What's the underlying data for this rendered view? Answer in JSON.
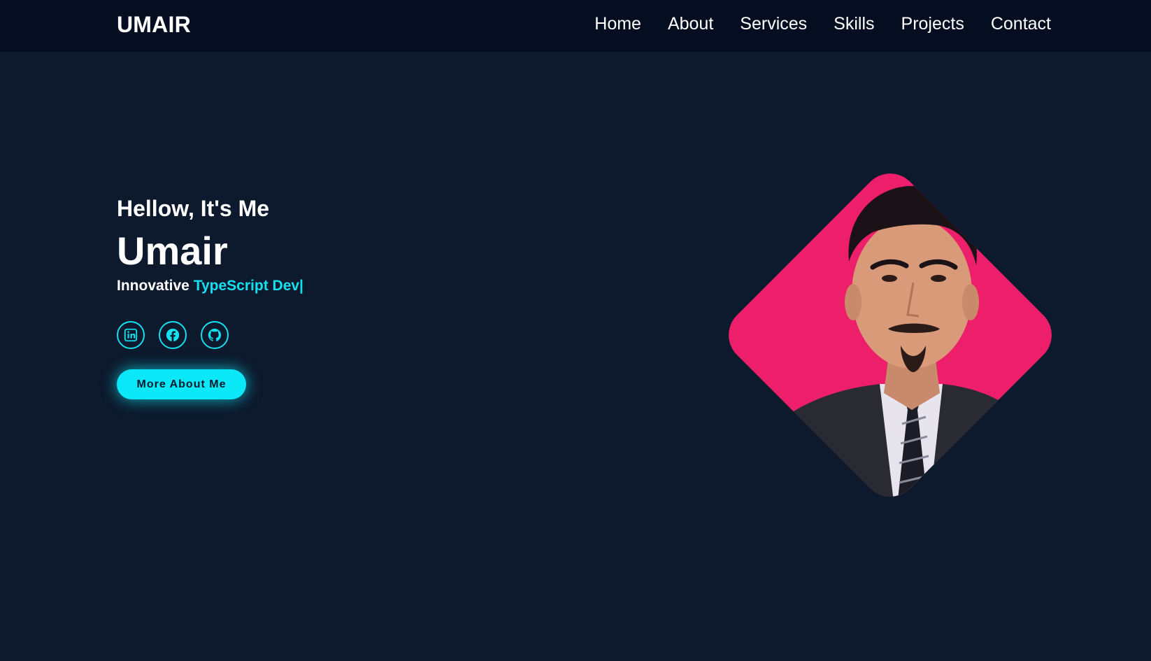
{
  "nav": {
    "logo": "UMAIR",
    "links": [
      "Home",
      "About",
      "Services",
      "Skills",
      "Projects",
      "Contact"
    ]
  },
  "hero": {
    "greeting": "Hellow, It's Me",
    "name": "Umair",
    "tagline_prefix": "Innovative",
    "tagline_highlight": "TypeScript Dev|",
    "cta_label": "More About Me",
    "socials": [
      "linkedin-icon",
      "facebook-icon",
      "github-icon"
    ]
  },
  "colors": {
    "background": "#0d192c",
    "navbar": "#050e20",
    "accent": "#14e0f0",
    "diamond": "#ee1f6a"
  }
}
